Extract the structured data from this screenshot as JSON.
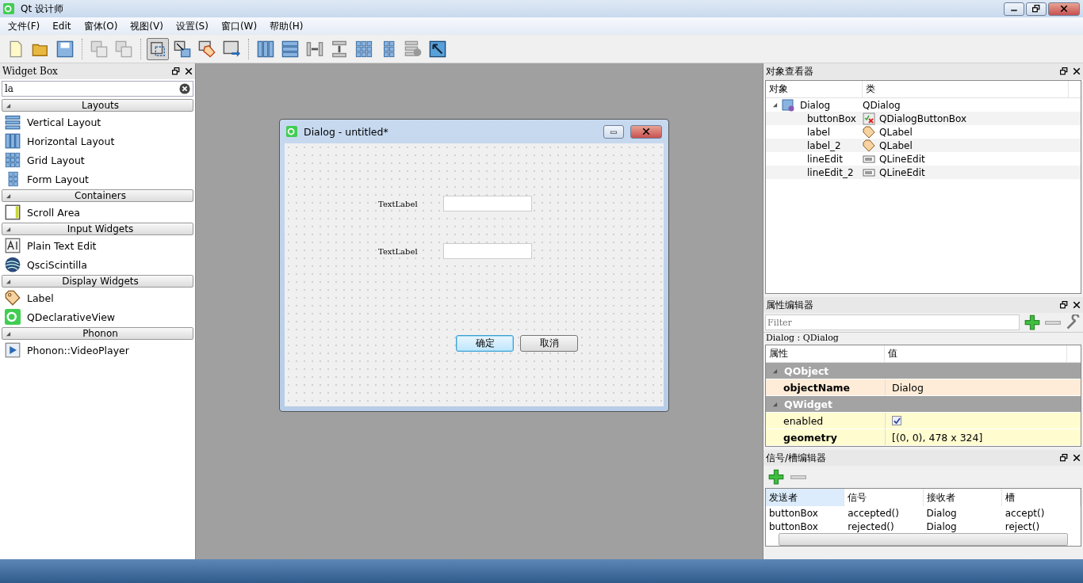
{
  "window": {
    "title": "Qt 设计师"
  },
  "menu": [
    "文件(F)",
    "Edit",
    "窗体(O)",
    "视图(V)",
    "设置(S)",
    "窗口(W)",
    "帮助(H)"
  ],
  "widget_box": {
    "title": "Widget Box",
    "search": {
      "value": "la"
    },
    "groups": [
      {
        "title": "Layouts",
        "expanded": true,
        "items": [
          {
            "label": "Vertical Layout",
            "kind": "vbox"
          },
          {
            "label": "Horizontal Layout",
            "kind": "hbox"
          },
          {
            "label": "Grid Layout",
            "kind": "grid"
          },
          {
            "label": "Form Layout",
            "kind": "form"
          }
        ]
      },
      {
        "title": "Containers",
        "expanded": true,
        "items": [
          {
            "label": "Scroll Area",
            "kind": "scroll"
          }
        ]
      },
      {
        "title": "Input Widgets",
        "expanded": true,
        "items": [
          {
            "label": "Plain Text Edit",
            "kind": "textedit"
          },
          {
            "label": "QsciScintilla",
            "kind": "scintilla"
          }
        ]
      },
      {
        "title": "Display Widgets",
        "expanded": true,
        "items": [
          {
            "label": "Label",
            "kind": "label"
          },
          {
            "label": "QDeclarativeView",
            "kind": "qt"
          }
        ]
      },
      {
        "title": "Phonon",
        "expanded": true,
        "items": [
          {
            "label": "Phonon::VideoPlayer",
            "kind": "video"
          }
        ]
      }
    ]
  },
  "form": {
    "title": "Dialog - untitled*",
    "rows": [
      {
        "label": "TextLabel",
        "value": ""
      },
      {
        "label": "TextLabel",
        "value": ""
      }
    ],
    "buttons": [
      {
        "label": "确定",
        "default": true
      },
      {
        "label": "取消",
        "default": false
      }
    ]
  },
  "object_inspector": {
    "title": "对象查看器",
    "columns": [
      "对象",
      "类"
    ],
    "tree": [
      {
        "name": "Dialog",
        "class": "QDialog",
        "kind": "dialog",
        "expanded": true,
        "children": [
          {
            "name": "buttonBox",
            "class": "QDialogButtonBox",
            "kind": "buttonbox"
          },
          {
            "name": "label",
            "class": "QLabel",
            "kind": "label"
          },
          {
            "name": "label_2",
            "class": "QLabel",
            "kind": "label"
          },
          {
            "name": "lineEdit",
            "class": "QLineEdit",
            "kind": "lineedit"
          },
          {
            "name": "lineEdit_2",
            "class": "QLineEdit",
            "kind": "lineedit"
          }
        ]
      }
    ]
  },
  "property_editor": {
    "title": "属性编辑器",
    "filter": {
      "placeholder": "Filter"
    },
    "object": "Dialog : QDialog",
    "columns": [
      "属性",
      "值"
    ],
    "rows": [
      {
        "kind": "group",
        "name": "QObject",
        "expanded": true
      },
      {
        "kind": "text",
        "name": "objectName",
        "value": "Dialog",
        "modified": true
      },
      {
        "kind": "group",
        "name": "QWidget",
        "expanded": true
      },
      {
        "kind": "checkbox",
        "name": "enabled",
        "checked": true,
        "modified": false
      },
      {
        "kind": "text",
        "name": "geometry",
        "value": "[(0, 0), 478 x 324]",
        "modified": true
      }
    ]
  },
  "signal_slot_editor": {
    "title": "信号/槽编辑器",
    "columns": [
      "发送者",
      "信号",
      "接收者",
      "槽"
    ],
    "rows": [
      [
        "buttonBox",
        "accepted()",
        "Dialog",
        "accept()"
      ],
      [
        "buttonBox",
        "rejected()",
        "Dialog",
        "reject()"
      ]
    ]
  }
}
